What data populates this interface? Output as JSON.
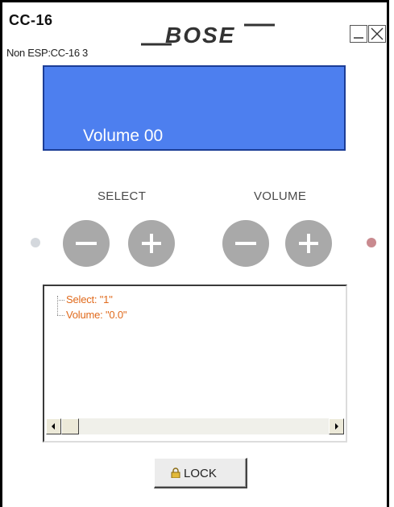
{
  "header": {
    "title": "CC-16",
    "subtitle": "Non ESP:CC-16 3",
    "logo_text": "BOSE"
  },
  "window_controls": {
    "minimize_icon": "minimize-icon",
    "close_icon": "close-icon"
  },
  "display": {
    "text": "Volume 00",
    "background_color": "#4d7fef"
  },
  "controls": {
    "select_label": "SELECT",
    "volume_label": "VOLUME",
    "buttons": [
      {
        "icon": "minus-icon",
        "group": "select"
      },
      {
        "icon": "plus-icon",
        "group": "select"
      },
      {
        "icon": "minus-icon",
        "group": "volume"
      },
      {
        "icon": "plus-icon",
        "group": "volume"
      }
    ],
    "indicator_left_color": "#d4d8dd",
    "indicator_right_color": "#c98a8f"
  },
  "tree": {
    "items": [
      {
        "label": "Select: \"1\""
      },
      {
        "label": "Volume: \"0.0\""
      }
    ],
    "item_color": "#e06a1c"
  },
  "lock_button": {
    "label": "LOCK",
    "icon": "lock-icon"
  }
}
